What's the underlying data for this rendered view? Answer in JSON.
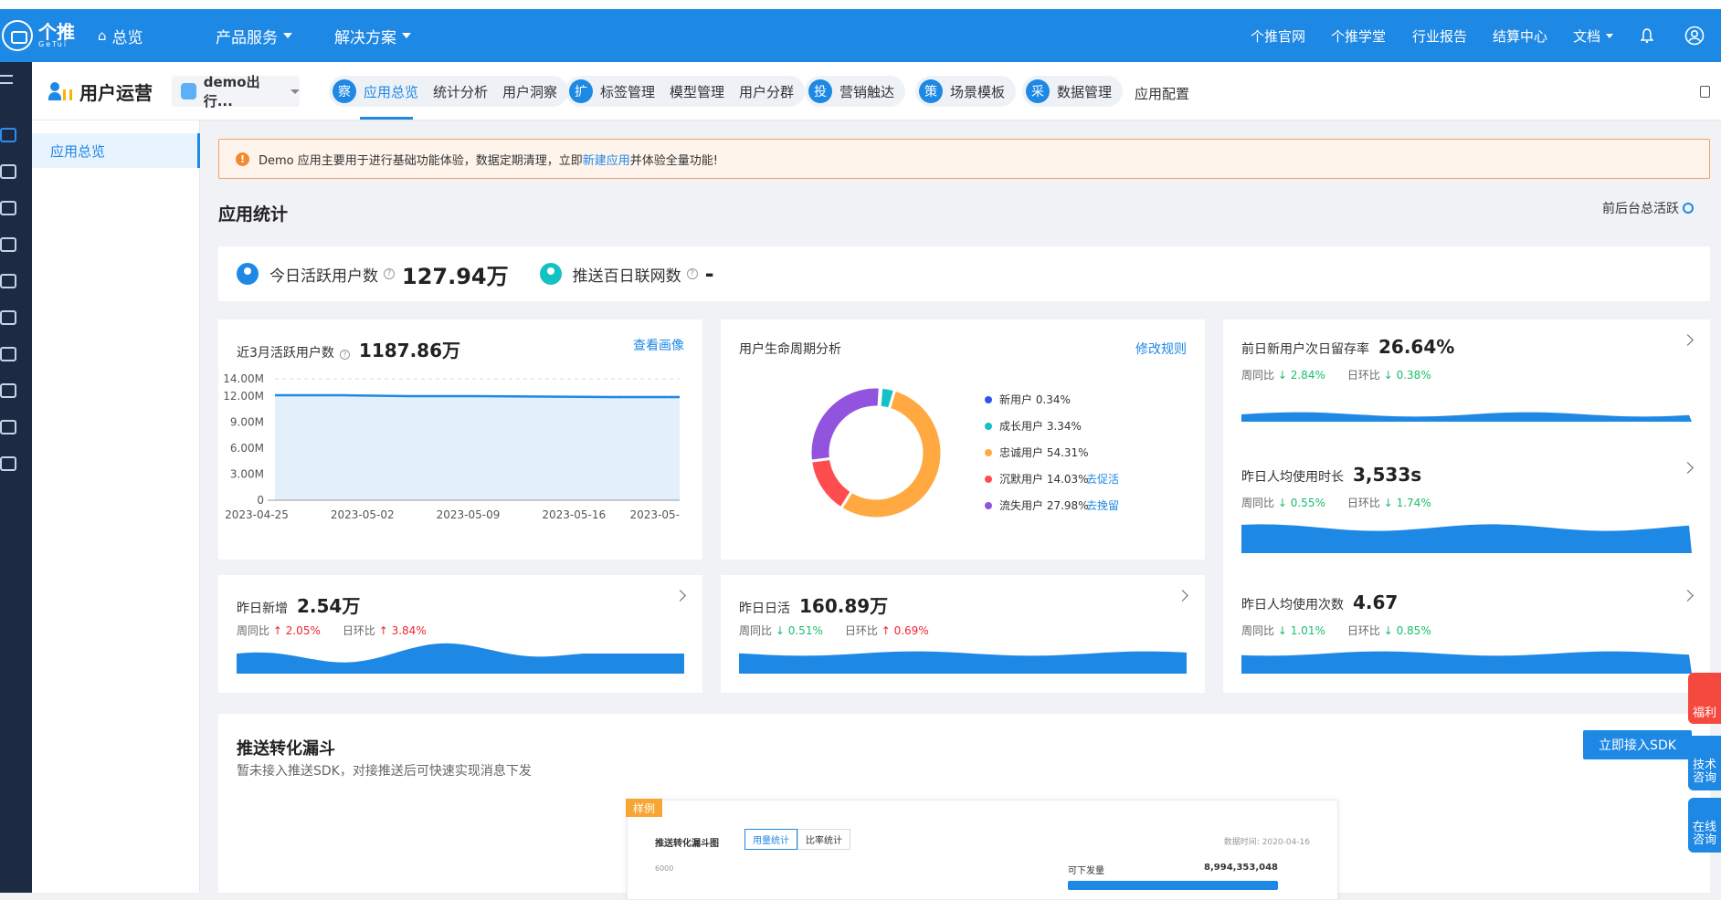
{
  "brand": {
    "name": "个推",
    "sub": "GeTui"
  },
  "topnav": {
    "home": "总览",
    "products": "产品服务",
    "solutions": "解决方案",
    "right": [
      "个推官网",
      "个推学堂",
      "行业报告",
      "结算中心",
      "文档"
    ]
  },
  "colors": {
    "primary": "#1e88e5",
    "sidebar": "#1c2a44",
    "up": "#f5222d",
    "down": "#19be6b"
  },
  "subheader": {
    "title": "用户运营",
    "app_selector": "demo出行...",
    "groups": [
      {
        "badge": "察",
        "tabs": [
          "应用总览",
          "统计分析",
          "用户洞察"
        ]
      },
      {
        "badge": "扩",
        "tabs": [
          "标签管理",
          "模型管理",
          "用户分群"
        ]
      },
      {
        "badge": "投",
        "tabs": [
          "营销触达"
        ]
      },
      {
        "badge": "策",
        "tabs": [
          "场景模板"
        ]
      },
      {
        "badge": "采",
        "tabs": [
          "数据管理"
        ]
      }
    ],
    "plain_tab": "应用配置",
    "active_tab": "应用总览"
  },
  "leftnav": {
    "items": [
      "应用总览"
    ]
  },
  "notice": {
    "icon": "!",
    "before": "Demo 应用主要用于进行基础功能体验，数据定期清理，立即",
    "link": "新建应用",
    "after": "并体验全量功能!"
  },
  "section": {
    "title": "应用统计",
    "toggle": "前后台总活跃"
  },
  "kpis": [
    {
      "label": "今日活跃用户数",
      "q": "?",
      "value": "127.94万"
    },
    {
      "label": "推送百日联网数",
      "q": "?",
      "value": "-"
    }
  ],
  "active_card": {
    "title": "近3月活跃用户数",
    "q": "?",
    "value": "1187.86万",
    "link": "查看画像",
    "chart_data": {
      "type": "area",
      "x": [
        "2023-04-25",
        "2023-05-02",
        "2023-05-09",
        "2023-05-16",
        "2023-05-"
      ],
      "yticks": [
        "14.00M",
        "12.00M",
        "9.00M",
        "6.00M",
        "3.00M",
        "0"
      ],
      "ylim": [
        0,
        14000000
      ],
      "values": [
        12100000,
        12100000,
        12000000,
        12000000,
        11950000,
        11900000,
        11900000
      ],
      "color": "#1e88e5"
    }
  },
  "lifecycle_card": {
    "title": "用户生命周期分析",
    "link": "修改规则",
    "chart_data": {
      "type": "pie",
      "series": [
        {
          "name": "新用户",
          "value": 0.34,
          "label": "0.34%",
          "color": "#2f54eb"
        },
        {
          "name": "成长用户",
          "value": 3.34,
          "label": "3.34%",
          "color": "#13c2c2"
        },
        {
          "name": "忠诚用户",
          "value": 54.31,
          "label": "54.31%",
          "color": "#ffa940"
        },
        {
          "name": "沉默用户",
          "value": 14.03,
          "label": "14.03%",
          "color": "#ff4d4f",
          "action": "去促活"
        },
        {
          "name": "流失用户",
          "value": 27.98,
          "label": "27.98%",
          "color": "#9254de",
          "action": "去挽留"
        }
      ]
    }
  },
  "stat_cards": [
    {
      "title": "前日新用户次日留存率",
      "value": "26.64%",
      "week": "周同比",
      "week_dir": "↓",
      "week_val": "2.84%",
      "day": "日环比",
      "day_dir": "↓",
      "day_val": "0.38%",
      "trend": "down"
    },
    {
      "title": "昨日人均使用时长",
      "value": "3,533s",
      "week": "周同比",
      "week_dir": "↓",
      "week_val": "0.55%",
      "day": "日环比",
      "day_dir": "↓",
      "day_val": "1.74%",
      "trend": "down"
    },
    {
      "title": "昨日新增",
      "value": "2.54万",
      "week": "周同比",
      "week_dir": "↑",
      "week_val": "2.05%",
      "day": "日环比",
      "day_dir": "↑",
      "day_val": "3.84%",
      "trend": "up"
    },
    {
      "title": "昨日日活",
      "value": "160.89万",
      "week": "周同比",
      "week_dir": "↓",
      "week_val": "0.51%",
      "day": "日环比",
      "day_dir": "↑",
      "day_val": "0.69%",
      "trend": "mixed"
    },
    {
      "title": "昨日人均使用次数",
      "value": "4.67",
      "week": "周同比",
      "week_dir": "↓",
      "week_val": "1.01%",
      "day": "日环比",
      "day_dir": "↓",
      "day_val": "0.85%",
      "trend": "down"
    }
  ],
  "funnel": {
    "title": "推送转化漏斗",
    "desc": "暂未接入推送SDK，对接推送后可快速实现消息下发",
    "button": "立即接入SDK",
    "sample": {
      "tag": "样例",
      "title": "推送转化漏斗图",
      "tab1": "用量统计",
      "tab2": "比率统计",
      "date": "数据时间: 2020-04-16",
      "axis": "6000",
      "row_label": "可下发量",
      "row_value": "8,994,353,048"
    }
  },
  "float": {
    "gift": "福利",
    "tech": "技术咨询",
    "online": "在线咨询"
  }
}
